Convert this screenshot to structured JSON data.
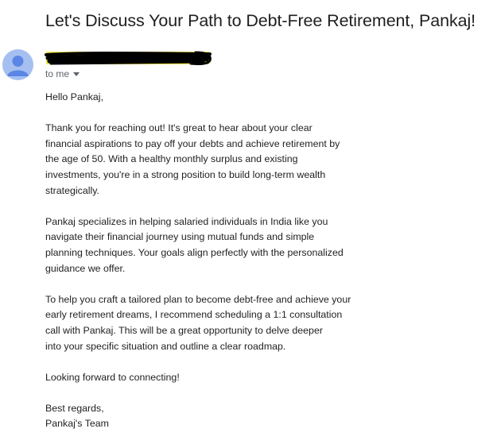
{
  "email": {
    "subject": "Let's Discuss Your Path to Debt-Free Retirement, Pankaj!",
    "recipient": "to me",
    "greeting": "Hello Pankaj,",
    "paragraph1": [
      "Thank you for reaching out! It's great to hear about your clear",
      "financial aspirations to pay off your debts and achieve retirement by",
      "the age of 50. With a healthy monthly surplus and existing",
      "investments, you're in a strong position to build long-term wealth",
      "strategically."
    ],
    "paragraph2": [
      "Pankaj specializes in helping salaried individuals in India like you",
      "navigate their financial journey using mutual funds and simple",
      "planning techniques. Your goals align perfectly with the personalized",
      "guidance we offer."
    ],
    "paragraph3": [
      "To help you craft a tailored plan to become debt-free and achieve your",
      "early retirement dreams, I recommend scheduling a 1:1 consultation",
      "call with Pankaj. This will be a great opportunity to delve deeper",
      "into your specific situation and outline a clear roadmap."
    ],
    "closing": "Looking forward to connecting!",
    "signoff": [
      "Best regards,",
      "Pankaj's Team"
    ]
  },
  "colors": {
    "avatar_bg": "#a5bff0",
    "avatar_fg": "#5b86e5",
    "redaction_highlight": "#f4e64a",
    "redaction_ink": "#000000"
  }
}
